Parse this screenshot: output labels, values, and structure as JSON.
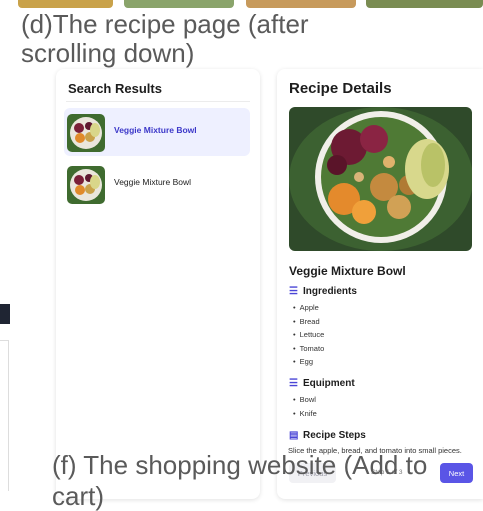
{
  "captions": {
    "d": "(d)The recipe page (after scrolling down)",
    "f_line1": "(f) The shopping website (Add to",
    "f_line2": "cart)"
  },
  "search_results": {
    "title": "Search Results",
    "items": [
      {
        "name": "Veggie Mixture Bowl",
        "active": true
      },
      {
        "name": "Veggie Mixture Bowl",
        "active": false
      }
    ]
  },
  "recipe": {
    "header": "Recipe Details",
    "name": "Veggie Mixture Bowl",
    "ingredients_title": "Ingredients",
    "ingredients": [
      "Apple",
      "Bread",
      "Lettuce",
      "Tomato",
      "Egg"
    ],
    "equipment_title": "Equipment",
    "equipment": [
      "Bowl",
      "Knife"
    ],
    "steps_title": "Recipe Steps",
    "step_text": "Slice the apple, bread, and tomato into small pieces.",
    "step_indicator": "Step 1 of 3",
    "prev_label": "Previous",
    "next_label": "Next"
  },
  "icons": {
    "ingredients": "list-icon",
    "equipment": "list-icon",
    "steps": "clipboard-icon"
  },
  "colors": {
    "accent": "#5a55e6",
    "active_bg": "#eef0ff",
    "active_text": "#3c38c9"
  }
}
